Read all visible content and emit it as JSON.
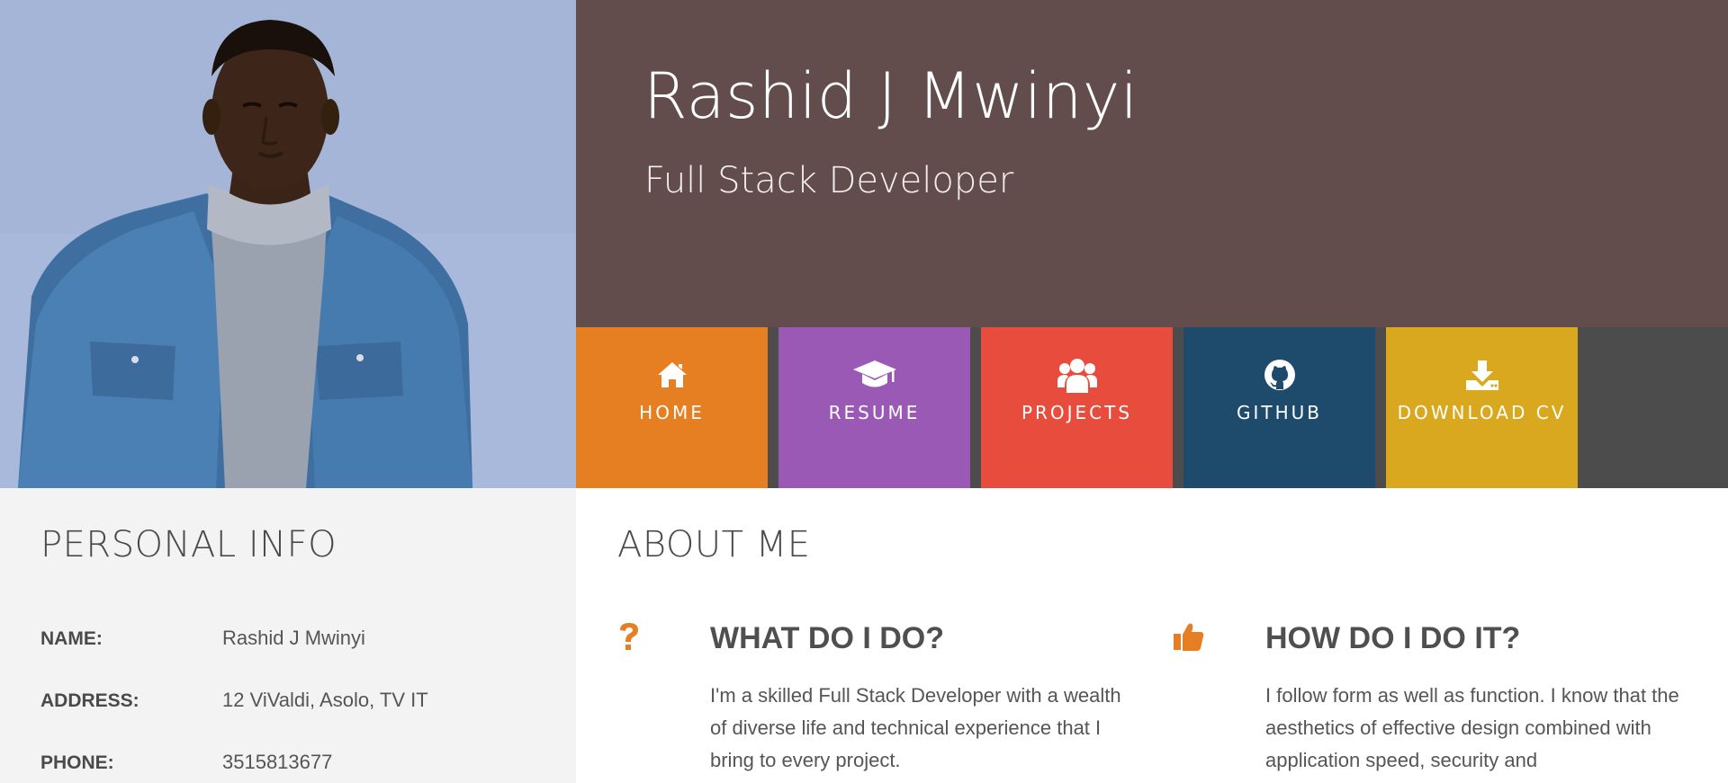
{
  "header": {
    "name": "Rashid J Mwinyi",
    "role": "Full Stack Developer"
  },
  "nav": [
    {
      "label": "HOME",
      "icon": "home-icon",
      "color": "#e67e22"
    },
    {
      "label": "RESUME",
      "icon": "graduation-cap-icon",
      "color": "#9b59b6"
    },
    {
      "label": "PROJECTS",
      "icon": "users-icon",
      "color": "#e74c3c"
    },
    {
      "label": "GITHUB",
      "icon": "github-icon",
      "color": "#1e4a6c"
    },
    {
      "label": "DOWNLOAD CV",
      "icon": "download-icon",
      "color": "#d9a81e"
    }
  ],
  "personal": {
    "title": "PERSONAL INFO",
    "rows": [
      {
        "key": "NAME:",
        "value": "Rashid J Mwinyi"
      },
      {
        "key": "ADDRESS:",
        "value": "12 ViValdi, Asolo, TV IT"
      },
      {
        "key": "PHONE:",
        "value": "3515813677"
      }
    ]
  },
  "about": {
    "title": "ABOUT ME",
    "columns": [
      {
        "icon": "question-icon",
        "heading": "WHAT DO I DO?",
        "text": "I'm a skilled Full Stack Developer with a wealth of diverse life and technical experience that I bring to every project."
      },
      {
        "icon": "thumbs-up-icon",
        "heading": "HOW DO I DO IT?",
        "text": "I follow form as well as function. I know that the aesthetics of effective design combined with application speed, security and"
      }
    ]
  },
  "colors": {
    "header_bg": "#634c4c",
    "accent": "#e67e22",
    "panel_bg": "#f3f3f3"
  }
}
